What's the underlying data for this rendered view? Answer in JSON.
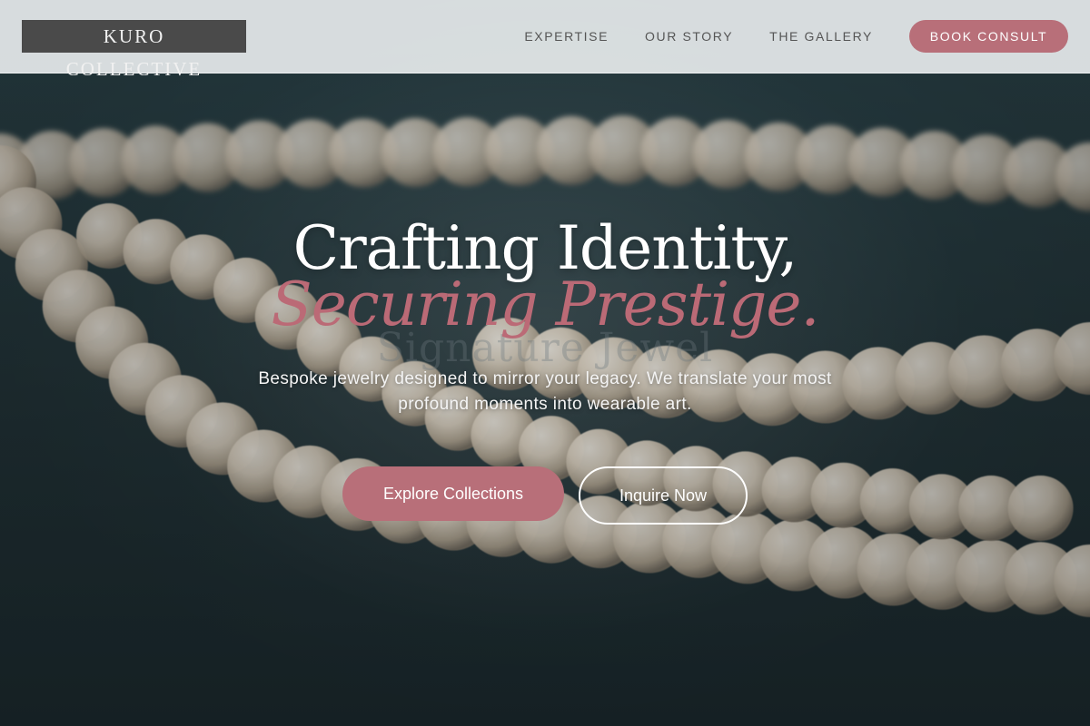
{
  "header": {
    "logo": "KURO COLLECTIVE",
    "nav": [
      "EXPERTISE",
      "OUR STORY",
      "THE GALLERY"
    ],
    "cta": "BOOK CONSULT"
  },
  "hero": {
    "headline_line1": "Crafting Identity,",
    "headline_line2": "Securing Prestige.",
    "ghost_text": "Signature Jewel",
    "subtitle": "Bespoke jewelry designed to mirror your legacy. We translate your most profound moments into wearable art.",
    "primary_button": "Explore Collections",
    "secondary_button": "Inquire Now"
  },
  "colors": {
    "accent": "#b86f79",
    "header_bg": "#e2e6e7",
    "logo_bg": "#4a4a4a",
    "hero_bg": "#2f4a51"
  },
  "background_image": "pearl-necklace-photo"
}
